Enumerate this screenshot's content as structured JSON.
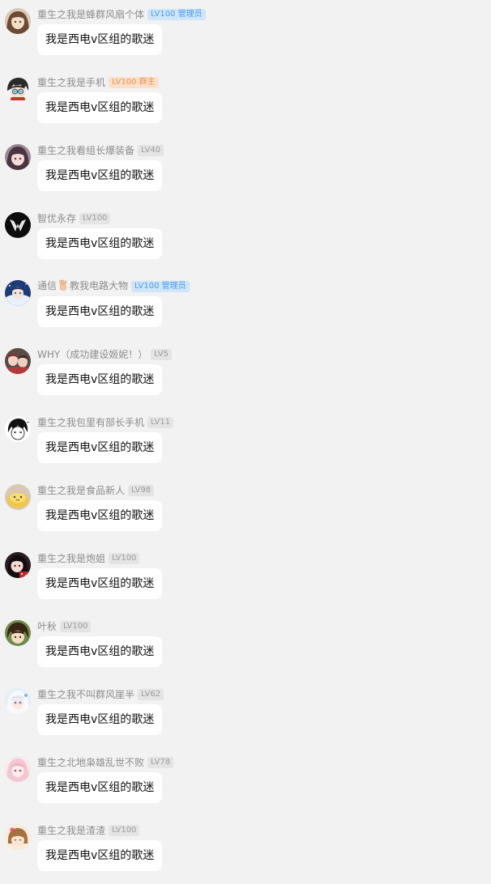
{
  "messages": [
    {
      "sender": "重生之我是蜂群风扇个体",
      "badge": "LV100 管理员",
      "badge_type": "admin",
      "text": "我是西电v区组的歌迷",
      "avatar_icon": "anime-girl-brown-hair-avatar"
    },
    {
      "sender": "重生之我是手机",
      "badge": "LV100 群主",
      "badge_type": "owner",
      "text": "我是西电v区组的歌迷",
      "avatar_icon": "anime-boy-glasses-avatar"
    },
    {
      "sender": "重生之我看组长爆装备",
      "badge": "LV40",
      "badge_type": "normal",
      "text": "我是西电v区组的歌迷",
      "avatar_icon": "anime-girl-dark-hair-avatar"
    },
    {
      "sender": "智优永存",
      "badge": "LV100",
      "badge_type": "normal",
      "text": "我是西电v区组的歌迷",
      "avatar_icon": "black-logo-avatar"
    },
    {
      "sender_before": "通信",
      "sender_after": "教我电路大物",
      "badge": "LV100 管理员",
      "badge_type": "admin",
      "text": "我是西电v区组的歌迷",
      "avatar_icon": "anime-starry-avatar",
      "inline_icon": "victory-hand-icon"
    },
    {
      "sender": "WHY（成功建设姬妮！）",
      "badge": "LV5",
      "badge_type": "normal",
      "text": "我是西电v区组的歌迷",
      "avatar_icon": "anime-group-avatar"
    },
    {
      "sender": "重生之我包里有部长手机",
      "badge": "LV11",
      "badge_type": "normal",
      "text": "我是西电v区组的歌迷",
      "avatar_icon": "manga-sketch-avatar"
    },
    {
      "sender": "重生之我是食品新人",
      "badge": "LV98",
      "badge_type": "normal",
      "text": "我是西电v区组的歌迷",
      "avatar_icon": "yellow-food-avatar"
    },
    {
      "sender": "重生之我是炮姐",
      "badge": "LV100",
      "badge_type": "normal",
      "text": "我是西电v区组的歌迷",
      "avatar_icon": "anime-girl-red-avatar"
    },
    {
      "sender": "叶秋",
      "badge": "LV100",
      "badge_type": "normal",
      "text": "我是西电v区组的歌迷",
      "avatar_icon": "anime-boy-brown-avatar"
    },
    {
      "sender": "重生之我不叫群风崖半",
      "badge": "LV62",
      "badge_type": "normal",
      "text": "我是西电v区组的歌迷",
      "avatar_icon": "anime-white-hair-avatar"
    },
    {
      "sender": "重生之北地枭雄乱世不败",
      "badge": "LV78",
      "badge_type": "normal",
      "text": "我是西电v区组的歌迷",
      "avatar_icon": "anime-pink-avatar"
    },
    {
      "sender": "重生之我是渣渣",
      "badge": "LV100",
      "badge_type": "normal",
      "text": "我是西电v区组的歌迷",
      "avatar_icon": "anime-chibi-avatar"
    }
  ]
}
